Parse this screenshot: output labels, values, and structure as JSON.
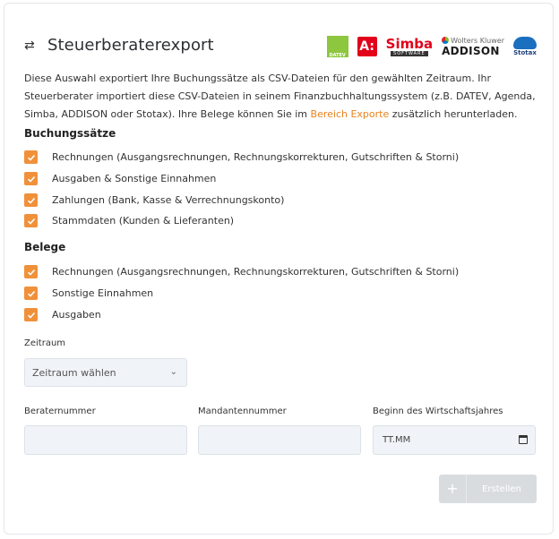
{
  "header": {
    "title": "Steuerberaterexport",
    "icon": "swap-arrows-icon"
  },
  "logos": {
    "datev": "DATEV",
    "addison_letter": "A:",
    "simba_main": "Simba",
    "simba_sub": "SOFTWARE",
    "wk_top": "Wolters Kluwer",
    "wk_main": "ADDISON",
    "stotax": "Stotax"
  },
  "description": {
    "text1": "Diese Auswahl exportiert Ihre Buchungssätze als CSV-Dateien für den gewählten Zeitraum. Ihr Steuerberater importiert diese CSV-Dateien in seinem Finanzbuchhaltungssystem (z.B. DATEV, Agenda, Simba, ADDISON oder Stotax). Ihre Belege können Sie im ",
    "link": "Bereich Exporte",
    "text2": " zusätzlich herunterladen."
  },
  "buchungssaetze": {
    "title": "Buchungssätze",
    "items": [
      {
        "label": "Rechnungen (Ausgangsrechnungen, Rechnungskorrekturen, Gutschriften & Storni)",
        "checked": true
      },
      {
        "label": "Ausgaben & Sonstige Einnahmen",
        "checked": true
      },
      {
        "label": "Zahlungen (Bank, Kasse & Verrechnungskonto)",
        "checked": true
      },
      {
        "label": "Stammdaten (Kunden & Lieferanten)",
        "checked": true
      }
    ]
  },
  "belege": {
    "title": "Belege",
    "items": [
      {
        "label": "Rechnungen (Ausgangsrechnungen, Rechnungskorrekturen, Gutschriften & Storni)",
        "checked": true
      },
      {
        "label": "Sonstige Einnahmen",
        "checked": true
      },
      {
        "label": "Ausgaben",
        "checked": true
      }
    ]
  },
  "zeitraum": {
    "label": "Zeitraum",
    "value": "Zeitraum wählen"
  },
  "fields": {
    "berater_label": "Beraternummer",
    "berater_value": "",
    "mandant_label": "Mandantennummer",
    "mandant_value": "",
    "wj_label": "Beginn des Wirtschaftsjahres",
    "wj_placeholder": "TT.MM"
  },
  "button": {
    "label": "Erstellen",
    "icon": "plus-icon"
  },
  "colors": {
    "accent": "#f0913a",
    "link": "#e8821f",
    "button_disabled": "#d9dcdf"
  }
}
